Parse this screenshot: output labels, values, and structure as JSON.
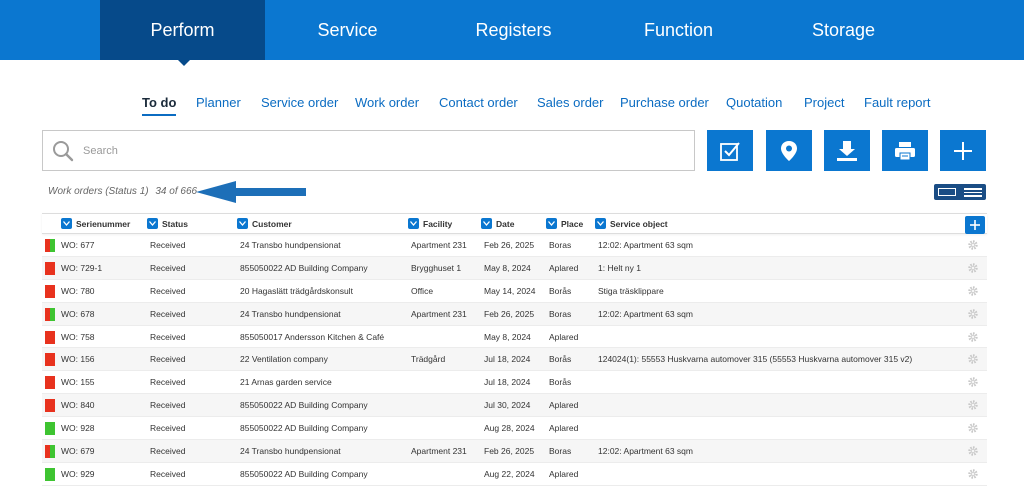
{
  "topnav": {
    "tabs": [
      {
        "label": "Perform",
        "active": true
      },
      {
        "label": "Service",
        "active": false
      },
      {
        "label": "Registers",
        "active": false
      },
      {
        "label": "Function",
        "active": false
      },
      {
        "label": "Storage",
        "active": false
      }
    ]
  },
  "subnav": {
    "items": [
      "To do",
      "Planner",
      "Service order",
      "Work order",
      "Contact order",
      "Sales order",
      "Purchase order",
      "Quotation",
      "Project",
      "Fault report"
    ]
  },
  "search": {
    "placeholder": "Search",
    "value": ""
  },
  "toolbar": {
    "icons": [
      "checklist-icon",
      "location-pin-icon",
      "download-icon",
      "printer-icon",
      "plus-icon"
    ]
  },
  "status": {
    "label": "Work orders (Status 1)",
    "count": "34 of 666"
  },
  "colors": {
    "brand": "#0b77d0",
    "brand_dark": "#064a8a",
    "red": "#e8321e",
    "green": "#3ec431"
  },
  "table": {
    "columns": [
      "Serienummer",
      "Status",
      "Customer",
      "Facility",
      "Date",
      "Place",
      "Service object"
    ],
    "rows": [
      {
        "ind": [
          "red",
          "green"
        ],
        "serial": "WO: 677",
        "status": "Received",
        "customer": "24 Transbo hundpensionat",
        "facility": "Apartment 231",
        "date": "Feb 26, 2025",
        "place": "Boras",
        "object": "12:02: Apartment 63 sqm"
      },
      {
        "ind": [
          "red"
        ],
        "serial": "WO: 729-1",
        "status": "Received",
        "customer": "855050022 AD Building Company",
        "facility": "Brygghuset 1",
        "date": "May 8, 2024",
        "place": "Aplared",
        "object": "1: Helt ny 1"
      },
      {
        "ind": [
          "red"
        ],
        "serial": "WO: 780",
        "status": "Received",
        "customer": "20 Hagaslätt trädgårdskonsult",
        "facility": "Office",
        "date": "May 14, 2024",
        "place": "Borås",
        "object": "Stiga träsklippare"
      },
      {
        "ind": [
          "red",
          "green"
        ],
        "serial": "WO: 678",
        "status": "Received",
        "customer": "24 Transbo hundpensionat",
        "facility": "Apartment 231",
        "date": "Feb 26, 2025",
        "place": "Boras",
        "object": "12:02: Apartment 63 sqm"
      },
      {
        "ind": [
          "red"
        ],
        "serial": "WO: 758",
        "status": "Received",
        "customer": "855050017 Andersson Kitchen & Café",
        "facility": "",
        "date": "May 8, 2024",
        "place": "Aplared",
        "object": ""
      },
      {
        "ind": [
          "red"
        ],
        "serial": "WO: 156",
        "status": "Received",
        "customer": "22 Ventilation company",
        "facility": "Trädgård",
        "date": "Jul 18, 2024",
        "place": "Borås",
        "object": "124024(1): 55553 Huskvarna automover 315 (55553 Huskvarna automover 315 v2)"
      },
      {
        "ind": [
          "red"
        ],
        "serial": "WO: 155",
        "status": "Received",
        "customer": "21 Arnas garden service",
        "facility": "",
        "date": "Jul 18, 2024",
        "place": "Borås",
        "object": ""
      },
      {
        "ind": [
          "red"
        ],
        "serial": "WO: 840",
        "status": "Received",
        "customer": "855050022 AD Building Company",
        "facility": "",
        "date": "Jul 30, 2024",
        "place": "Aplared",
        "object": ""
      },
      {
        "ind": [
          "green"
        ],
        "serial": "WO: 928",
        "status": "Received",
        "customer": "855050022 AD Building Company",
        "facility": "",
        "date": "Aug 28, 2024",
        "place": "Aplared",
        "object": ""
      },
      {
        "ind": [
          "red",
          "green"
        ],
        "serial": "WO: 679",
        "status": "Received",
        "customer": "24 Transbo hundpensionat",
        "facility": "Apartment 231",
        "date": "Feb 26, 2025",
        "place": "Boras",
        "object": "12:02: Apartment 63 sqm"
      },
      {
        "ind": [
          "green"
        ],
        "serial": "WO: 929",
        "status": "Received",
        "customer": "855050022 AD Building Company",
        "facility": "",
        "date": "Aug 22, 2024",
        "place": "Aplared",
        "object": ""
      }
    ]
  }
}
